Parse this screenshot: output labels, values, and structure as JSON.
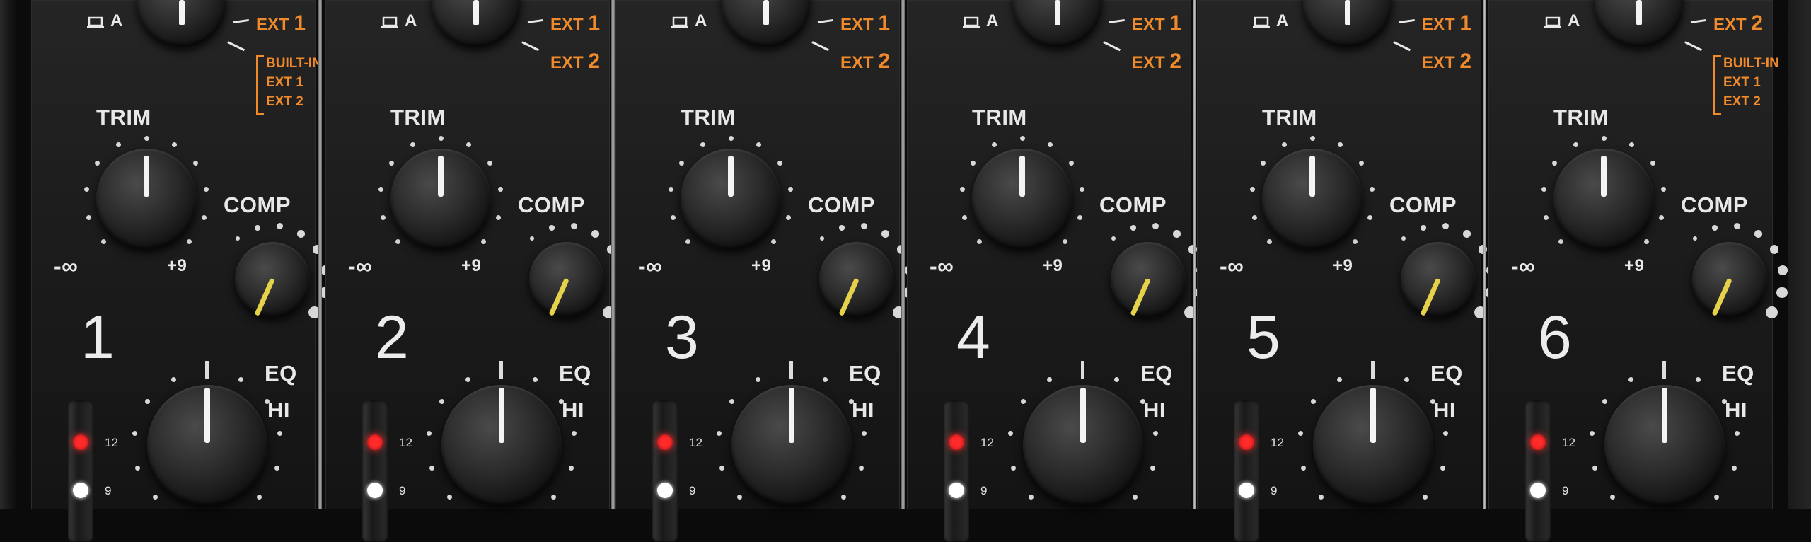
{
  "channels": [
    {
      "number": "1",
      "trim": "TRIM",
      "minus": "-∞",
      "plus": "+9",
      "comp": "COMP",
      "eq": "EQ",
      "hi": "HI",
      "src_a": "A",
      "ext_top": "EXT",
      "ext_top_num": "1",
      "ext_bottom": "",
      "ext_bottom_num": "",
      "bracket": [
        "BUILT-IN",
        "EXT 1",
        "EXT 2"
      ],
      "meter_12": "12",
      "meter_9": "9"
    },
    {
      "number": "2",
      "trim": "TRIM",
      "minus": "-∞",
      "plus": "+9",
      "comp": "COMP",
      "eq": "EQ",
      "hi": "HI",
      "src_a": "A",
      "ext_top": "EXT",
      "ext_top_num": "1",
      "ext_bottom": "EXT",
      "ext_bottom_num": "2",
      "bracket": [],
      "meter_12": "12",
      "meter_9": "9"
    },
    {
      "number": "3",
      "trim": "TRIM",
      "minus": "-∞",
      "plus": "+9",
      "comp": "COMP",
      "eq": "EQ",
      "hi": "HI",
      "src_a": "A",
      "ext_top": "EXT",
      "ext_top_num": "1",
      "ext_bottom": "EXT",
      "ext_bottom_num": "2",
      "bracket": [],
      "meter_12": "12",
      "meter_9": "9"
    },
    {
      "number": "4",
      "trim": "TRIM",
      "minus": "-∞",
      "plus": "+9",
      "comp": "COMP",
      "eq": "EQ",
      "hi": "HI",
      "src_a": "A",
      "ext_top": "EXT",
      "ext_top_num": "1",
      "ext_bottom": "EXT",
      "ext_bottom_num": "2",
      "bracket": [],
      "meter_12": "12",
      "meter_9": "9"
    },
    {
      "number": "5",
      "trim": "TRIM",
      "minus": "-∞",
      "plus": "+9",
      "comp": "COMP",
      "eq": "EQ",
      "hi": "HI",
      "src_a": "A",
      "ext_top": "EXT",
      "ext_top_num": "1",
      "ext_bottom": "EXT",
      "ext_bottom_num": "2",
      "bracket": [],
      "meter_12": "12",
      "meter_9": "9"
    },
    {
      "number": "6",
      "trim": "TRIM",
      "minus": "-∞",
      "plus": "+9",
      "comp": "COMP",
      "eq": "EQ",
      "hi": "HI",
      "src_a": "A",
      "ext_top": "EXT",
      "ext_top_num": "2",
      "ext_bottom": "",
      "ext_bottom_num": "",
      "bracket": [
        "BUILT-IN",
        "EXT 1",
        "EXT 2"
      ],
      "meter_12": "12",
      "meter_9": "9"
    }
  ],
  "colors": {
    "accent_orange": "#f08a2a",
    "comp_indicator": "#e6d24a",
    "led_red": "#ff2a2a",
    "led_white": "#ffffff"
  },
  "icons": {
    "source_icon": "laptop-icon"
  }
}
